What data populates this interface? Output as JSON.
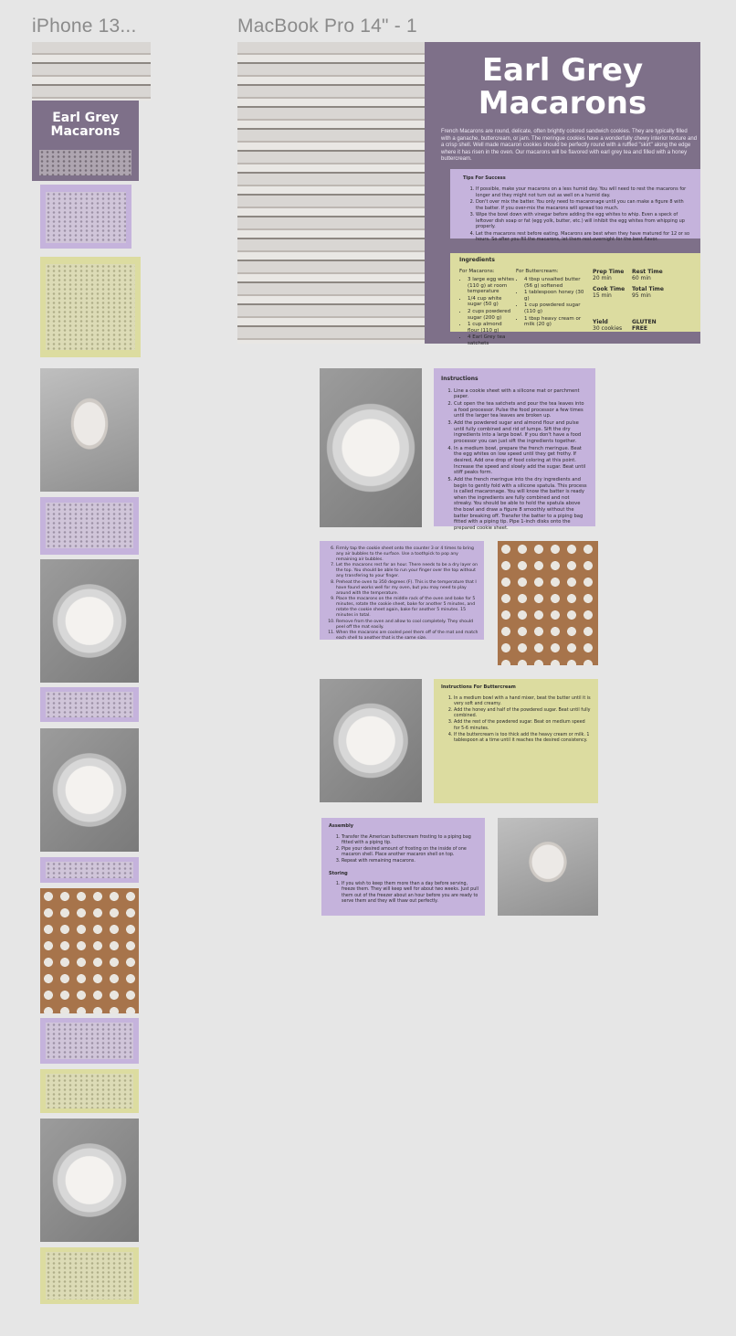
{
  "frames": {
    "iphone_label": "iPhone 13...",
    "macbook_label": "MacBook Pro 14\" - 1"
  },
  "colors": {
    "purple": "#7e7089",
    "lavender": "#c5b3dc",
    "yellow": "#dcdca0",
    "canvas": "#e6e6e6"
  },
  "recipe": {
    "title_line1": "Earl Grey",
    "title_line2": "Macarons",
    "intro": "French Macarons are round, delicate, often brightly colored sandwich cookies. They are typically filled with a ganache, buttercream, or jam. The meringue cookies have a wonderfully chewy interior texture and a crisp shell. Well made macaron cookies should be perfectly round with a ruffled \"skirt\" along the edge where it has risen in the oven. Our macarons will be flavored with earl grey tea and filled with a honey buttercream.",
    "tips": {
      "heading": "Tips For Success",
      "items": [
        "If possible, make your macarons on a less humid day. You will need to rest the macarons for longer and they might not turn out as well on a humid day.",
        "Don't over mix the batter. You only need to macaronage until you can make a figure 8 with the batter. If you over-mix the macarons will spread too much.",
        "Wipe the bowl down with vinegar before adding the egg whites to whip. Even a speck of leftover dish soap or fat (egg yolk, butter, etc.) will inhibit the egg whites from whipping up properly.",
        "Let the macarons rest before eating. Macarons are best when they have matured for 12 or so hours. So after you fill the macarons, let them rest overnight for the best flavor."
      ]
    },
    "ingredients": {
      "heading": "Ingredients",
      "macarons_heading": "For Macarons:",
      "macarons": [
        "3 large egg whites (110 g) at room temperature",
        "1/4 cup white sugar (50 g)",
        "2 cups powdered sugar (200 g)",
        "1 cup almond flour (110 g)",
        "4 Earl Grey tea satchets"
      ],
      "buttercream_heading": "For Buttercream:",
      "buttercream": [
        "4 tbsp unsalted butter (56 g) softened",
        "1 tablespoon honey (30 g)",
        "1 cup powdered sugar (110 g)",
        "1 tbsp heavy cream or milk (20 g)"
      ]
    },
    "meta": {
      "prep_label": "Prep Time",
      "prep_value": "20 min",
      "rest_label": "Rest Time",
      "rest_value": "60 min",
      "cook_label": "Cook Time",
      "cook_value": "15 min",
      "total_label": "Total Time",
      "total_value": "95 min",
      "yield_label": "Yield",
      "yield_value": "30 cookies",
      "gf_label": "GLUTEN FREE"
    },
    "instructions": {
      "heading": "Instructions",
      "items": [
        "Line a cookie sheet with a silicone mat or parchment paper.",
        "Cut open the tea satchets and pour the tea leaves into a food processor. Pulse the food processor a few times until the larger tea leaves are broken up.",
        "Add the powdered sugar and almond flour and pulse until fully combined and rid of lumps. Sift the dry ingredients into a large bowl. If you don't have a food processor you can just sift the ingredients together.",
        "In a medium bowl, prepare the french meringue. Beat the egg whites on low speed until they get frothy. If desired, Add one drop of food coloring at this point. Increase the speed and slowly add the sugar. Beat until stiff peaks form.",
        "Add the french meringue into the dry ingredients and begin to gently fold with a silicone spatula. This process is called macaronage. You will know the batter is ready when the ingredients are fully combined and not streaky. You should be able to hold the spatula above the bowl and draw a figure 8 smoothly without the batter breaking off. Transfer the batter to a piping bag fitted with a piping tip. Pipe 1-inch disks onto the prepared cookie sheet."
      ]
    },
    "instructions2": {
      "items": [
        "Firmly tap the cookie sheet onto the counter 3 or 4 times to bring any air bubbles to the surface. Use a toothpick to pop any remaining air bubbles.",
        "Let the macarons rest for an hour. There needs to be a dry layer on the top. You should be able to run your finger over the top without any transfering to your finger.",
        "Preheat the oven to 350 degrees (F). This is the temperature that I have found works well for my oven, but you may need to play around with the temperature.",
        "Place the macarons on the middle rack of the oven and bake for 5 minutes, rotate the cookie sheet, bake for another 5 minutes, and rotate the cookie sheet again, bake for another 5 minutes. 15 minutes in total.",
        "Remove from the oven and allow to cool completely. They should peel off the mat easily.",
        "When the macarons are cooled peel them off of the mat and match each shell to another that is the same size."
      ]
    },
    "buttercream_instructions": {
      "heading": "Instructions For Buttercream",
      "items": [
        "In a medium bowl with a hand mixer, beat the butter until it is very soft and creamy.",
        "Add the honey and half of the powdered sugar. Beat until fully combined.",
        "Add the rest of the powdered sugar. Beat on medium speed for 5-6 minutes.",
        "If the buttercream is too thick add the heavy cream or milk. 1 tablespoon at a time until it reaches the desired consistency."
      ]
    },
    "assembly": {
      "heading": "Assembly",
      "items": [
        "Transfer the American buttercream frosting to a piping bag fitted with a piping tip.",
        "Pipe your desired amount of frosting on the inside of one macaron shell. Place another macaron shell on top.",
        "Repeat with remaining macarons."
      ],
      "storing_heading": "Storing",
      "storing_items": [
        "If you wish to keep them more than a day before serving, freeze them. They will keep well for about two weeks. Just pull them out of the freezer about an hour before you are ready to serve them and they will thaw out perfectly."
      ]
    }
  }
}
